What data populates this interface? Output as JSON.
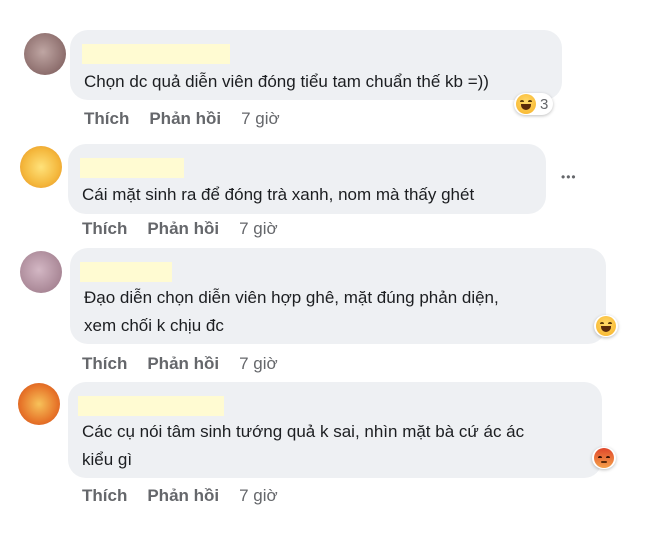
{
  "comments": [
    {
      "text": "Chọn dc quả diễn viên đóng tiểu tam chuẩn thế kb =))",
      "reaction_count": "3",
      "like": "Thích",
      "reply": "Phản hồi",
      "time": "7 giờ",
      "reaction_icon": "haha-icon"
    },
    {
      "text": "Cái mặt sinh ra để đóng trà xanh, nom mà thấy ghét",
      "like": "Thích",
      "reply": "Phản hồi",
      "time": "7 giờ",
      "more": "•••"
    },
    {
      "text": "Đạo diễn chọn diễn viên hợp ghê, mặt đúng phản diện,\nxem chối k chịu đc",
      "like": "Thích",
      "reply": "Phản hồi",
      "time": "7 giờ",
      "reaction_icon": "haha-icon"
    },
    {
      "text": "Các cụ nói tâm sinh tướng quả k sai, nhìn mặt bà cứ ác ác\nkiểu gì",
      "like": "Thích",
      "reply": "Phản hồi",
      "time": "7 giờ",
      "reaction_icon": "angry-icon"
    }
  ],
  "colors": {
    "bubble": "#eef0f3",
    "action_text": "#65676b",
    "redaction": "#fffbd2"
  }
}
